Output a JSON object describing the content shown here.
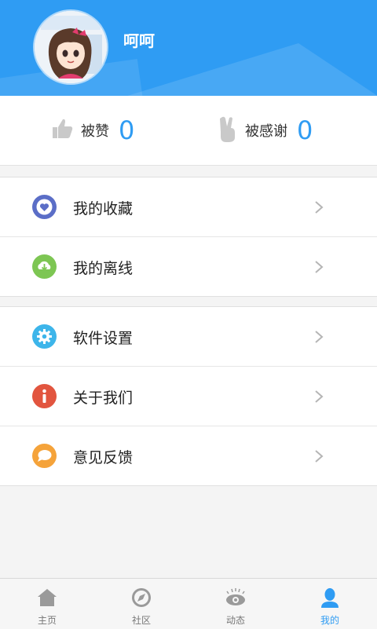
{
  "profile": {
    "name": "呵呵"
  },
  "stats": {
    "likes": {
      "label": "被赞",
      "value": "0"
    },
    "thanks": {
      "label": "被感谢",
      "value": "0"
    }
  },
  "menu": {
    "favorites": "我的收藏",
    "offline": "我的离线",
    "settings": "软件设置",
    "about": "关于我们",
    "feedback": "意见反馈"
  },
  "tabs": {
    "home": "主页",
    "community": "社区",
    "activity": "动态",
    "mine": "我的"
  },
  "colors": {
    "accent": "#2f9cf3",
    "favorites_icon": "#5b6ec7",
    "offline_icon": "#7dc653",
    "settings_icon": "#3db5ea",
    "about_icon": "#e2553f",
    "feedback_icon": "#f5a33a"
  }
}
